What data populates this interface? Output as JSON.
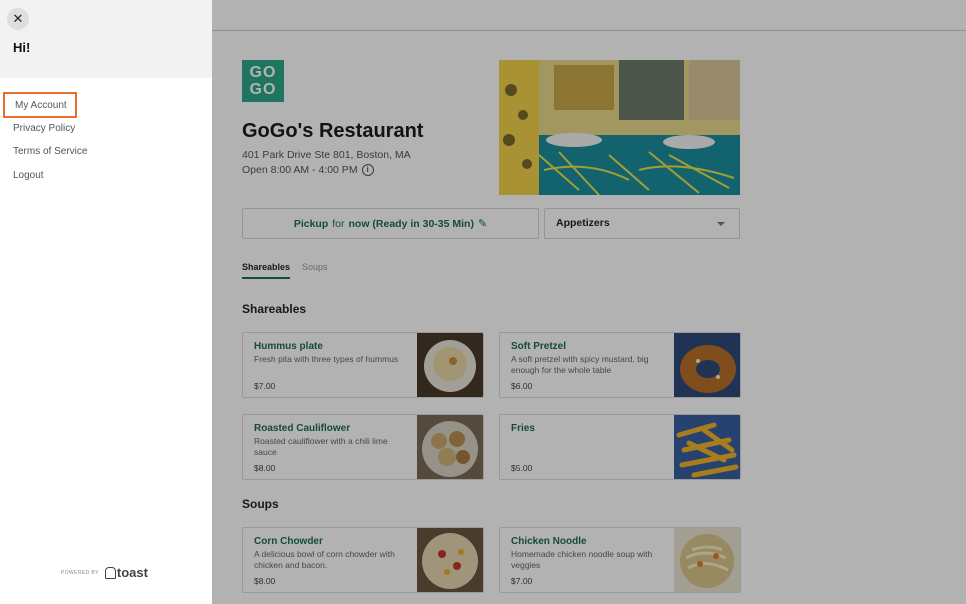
{
  "drawer": {
    "close_icon": "close-icon",
    "greeting": "Hi!",
    "nav": [
      {
        "label": "My Account"
      },
      {
        "label": "Privacy Policy"
      },
      {
        "label": "Terms of Service"
      },
      {
        "label": "Logout"
      }
    ],
    "powered_by": "POWERED BY",
    "brand": "toast"
  },
  "restaurant": {
    "logo_line1": "GO",
    "logo_line2": "GO",
    "name": "GoGo's Restaurant",
    "address": "401 Park Drive Ste 801, Boston, MA",
    "hours": "Open 8:00 AM - 4:00 PM"
  },
  "order": {
    "pickup_word": "Pickup",
    "pickup_rest": "for",
    "pickup_time": "now (Ready in 30-35 Min)",
    "category_selected": "Appetizers"
  },
  "tabs": [
    {
      "label": "Shareables"
    },
    {
      "label": "Soups"
    }
  ],
  "sections": [
    {
      "title": "Shareables",
      "items": [
        {
          "name": "Hummus plate",
          "desc": "Fresh pita with three types of hummus",
          "price": "$7.00"
        },
        {
          "name": "Soft Pretzel",
          "desc": "A soft pretzel with spicy mustard, big enough for the whole table",
          "price": "$6.00"
        },
        {
          "name": "Roasted Cauliflower",
          "desc": "Roasted cauliflower with a chili lime sauce",
          "price": "$8.00"
        },
        {
          "name": "Fries",
          "desc": "",
          "price": "$5.00"
        }
      ]
    },
    {
      "title": "Soups",
      "items": [
        {
          "name": "Corn Chowder",
          "desc": "A delicious bowl of corn chowder with chicken and bacon.",
          "price": "$8.00"
        },
        {
          "name": "Chicken Noodle",
          "desc": "Homemade chicken noodle soup with veggies",
          "price": "$7.00"
        }
      ]
    }
  ],
  "colors": {
    "accent": "#1e6b5d",
    "logo_bg": "#2fa88b",
    "focus_ring": "#e8702a"
  }
}
